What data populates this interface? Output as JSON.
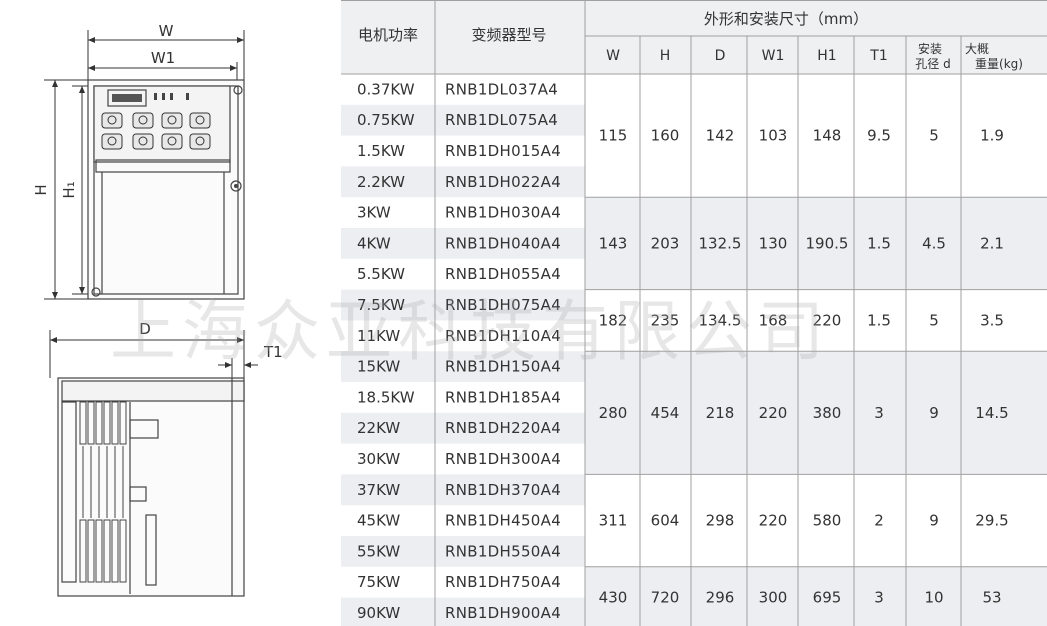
{
  "diagram": {
    "front": {
      "w_label": "W",
      "w1_label": "W1",
      "h_label": "H",
      "h1_label": "H₁"
    },
    "side": {
      "d_label": "D",
      "t1_label": "T1"
    }
  },
  "table": {
    "header": {
      "motor_power": "电机功率",
      "model": "变频器型号",
      "group": "外形和安装尺寸（mm）",
      "cols": [
        "W",
        "H",
        "D",
        "W1",
        "H1",
        "T1"
      ],
      "hole_line1": "安装",
      "hole_line2": "孔径 d",
      "weight_line1": "大概",
      "weight_line2": "重量(kg)"
    },
    "rows": [
      {
        "power": "0.37KW",
        "model": "RNB1DL037A4"
      },
      {
        "power": "0.75KW",
        "model": "RNB1DL075A4"
      },
      {
        "power": "1.5KW",
        "model": "RNB1DH015A4"
      },
      {
        "power": "2.2KW",
        "model": "RNB1DH022A4"
      },
      {
        "power": "3KW",
        "model": "RNB1DH030A4"
      },
      {
        "power": "4KW",
        "model": "RNB1DH040A4"
      },
      {
        "power": "5.5KW",
        "model": "RNB1DH055A4"
      },
      {
        "power": "7.5KW",
        "model": "RNB1DH075A4"
      },
      {
        "power": "11KW",
        "model": "RNB1DH110A4"
      },
      {
        "power": "15KW",
        "model": "RNB1DH150A4"
      },
      {
        "power": "18.5KW",
        "model": "RNB1DH185A4"
      },
      {
        "power": "22KW",
        "model": "RNB1DH220A4"
      },
      {
        "power": "30KW",
        "model": "RNB1DH300A4"
      },
      {
        "power": "37KW",
        "model": "RNB1DH370A4"
      },
      {
        "power": "45KW",
        "model": "RNB1DH450A4"
      },
      {
        "power": "55KW",
        "model": "RNB1DH550A4"
      },
      {
        "power": "75KW",
        "model": "RNB1DH750A4"
      },
      {
        "power": "90KW",
        "model": "RNB1DH900A4"
      }
    ],
    "groups": [
      {
        "rows": 4,
        "values": [
          "115",
          "160",
          "142",
          "103",
          "148",
          "9.5",
          "5",
          "1.9"
        ]
      },
      {
        "rows": 3,
        "values": [
          "143",
          "203",
          "132.5",
          "130",
          "190.5",
          "1.5",
          "4.5",
          "2.1"
        ]
      },
      {
        "rows": 2,
        "values": [
          "182",
          "235",
          "134.5",
          "168",
          "220",
          "1.5",
          "5",
          "3.5"
        ]
      },
      {
        "rows": 4,
        "values": [
          "280",
          "454",
          "218",
          "220",
          "380",
          "3",
          "9",
          "14.5"
        ]
      },
      {
        "rows": 3,
        "values": [
          "311",
          "604",
          "298",
          "220",
          "580",
          "2",
          "9",
          "29.5"
        ]
      },
      {
        "rows": 2,
        "values": [
          "430",
          "720",
          "296",
          "300",
          "695",
          "3",
          "10",
          "53"
        ]
      }
    ]
  },
  "watermark": "上海众亚科技有限公司",
  "colors": {
    "header_bg": "#eef0f2",
    "band_bg": "#eceef1",
    "rule": "#a0a0a0",
    "text": "#333333"
  }
}
